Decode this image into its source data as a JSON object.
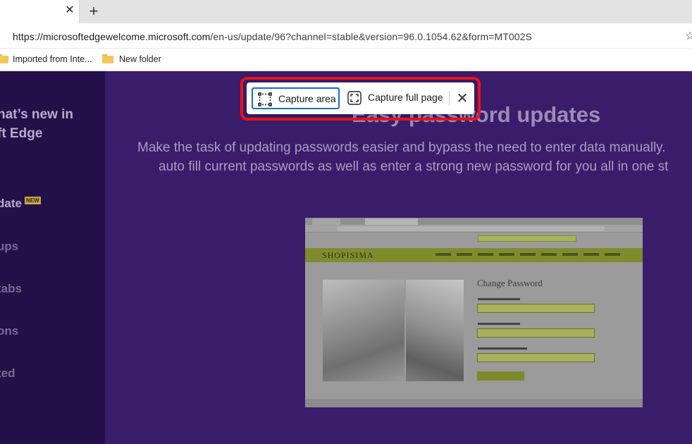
{
  "tabs": {
    "close_symbol": "✕",
    "new_tab_symbol": "+"
  },
  "address_bar": {
    "url_host": "https://microsoftedgewelcome.microsoft.com",
    "url_path": "/en-us/update/96?channel=stable&version=96.0.1054.62&form=MT002S",
    "favorite_icon": "star-icon"
  },
  "favorites_bar": {
    "items": [
      {
        "label": "Imported from Inte...",
        "icon": "folder-icon"
      },
      {
        "label": "New folder",
        "icon": "folder-icon"
      }
    ]
  },
  "sidebar": {
    "title_line1": "hat’s new in",
    "title_line2": "ft Edge",
    "items": [
      {
        "label": "date",
        "badge": "NEW",
        "active": true
      },
      {
        "label": "ups"
      },
      {
        "label": "tabs"
      },
      {
        "label": "ons"
      },
      {
        "label": "ted"
      }
    ]
  },
  "main": {
    "headline": "Easy password updates",
    "description_line1": "Make the task of updating passwords easier and bypass the need to enter data manually.",
    "description_line2": "auto fill current passwords as well as enter a strong new password for you all in one st"
  },
  "embedded_screenshot": {
    "brand": "SHOPISIMA",
    "form_title": "Change Password"
  },
  "capture_toolbar": {
    "capture_area_label": "Capture area",
    "capture_full_page_label": "Capture full page",
    "close_symbol": "✕",
    "highlight_color": "#e8131c",
    "selected_border_color": "#1b6bc8"
  }
}
